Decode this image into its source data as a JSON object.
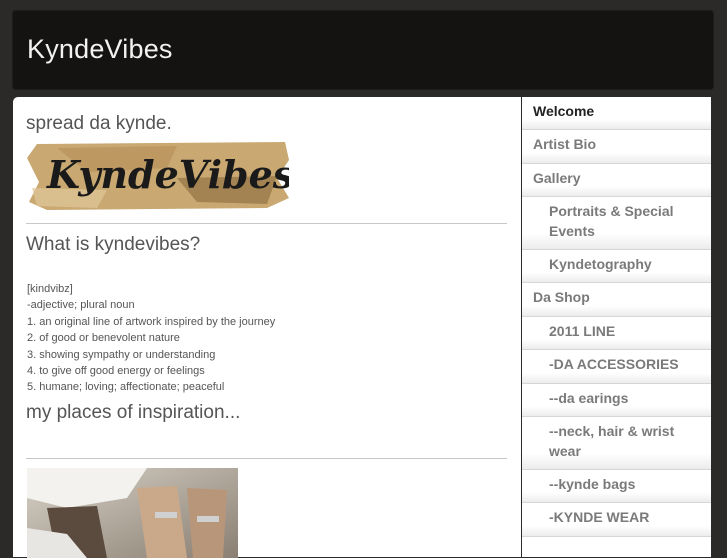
{
  "site": {
    "title": "KyndeVibes"
  },
  "main": {
    "heading_spread": "spread da kynde.",
    "logo_text": "KyndeVibes",
    "heading_what": "What is kyndevibes?",
    "definitions": [
      "[kindvibz]",
      "-adjective; plural noun",
      "1. an original line of artwork inspired by the journey",
      "2. of good or benevolent nature",
      "3. showing sympathy or understanding",
      "4. to give off good energy or feelings",
      "5. humane; loving; affectionate; peaceful"
    ],
    "heading_places": "my places of inspiration..."
  },
  "nav": {
    "items": [
      {
        "label": "Welcome",
        "active": true
      },
      {
        "label": "Artist Bio"
      },
      {
        "label": "Gallery"
      },
      {
        "label": "Portraits & Special Events",
        "sub": true
      },
      {
        "label": "Kyndetography",
        "sub": true
      },
      {
        "label": "Da Shop"
      },
      {
        "label": "2011 LINE",
        "sub": true
      },
      {
        "label": "-DA ACCESSORIES",
        "sub": true
      },
      {
        "label": "--da earings",
        "sub": true
      },
      {
        "label": "--neck, hair & wrist wear",
        "sub": true
      },
      {
        "label": "--kynde bags",
        "sub": true
      },
      {
        "label": "-KYNDE WEAR",
        "sub": true
      }
    ]
  },
  "colors": {
    "header_bg": "#141312",
    "page_bg": "#2b2a29"
  }
}
